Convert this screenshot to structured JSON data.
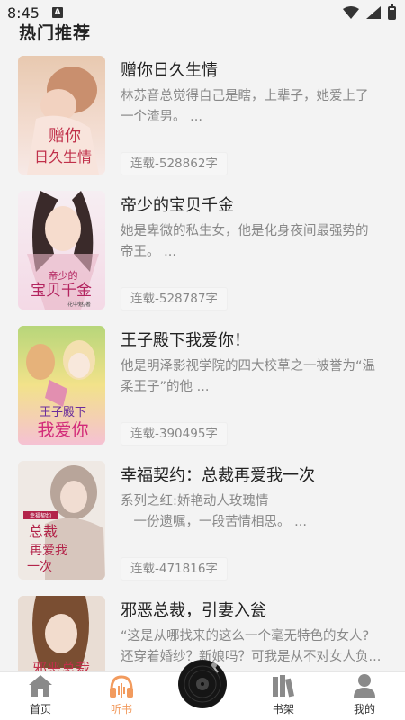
{
  "status_bar": {
    "time": "8:45",
    "notification_letter": "A"
  },
  "section": {
    "title": "热门推荐"
  },
  "books": [
    {
      "title": "赠你日久生情",
      "desc_lines": [
        "林苏音总觉得自己是瞎，上辈子，她爱上了",
        "一个渣男。 ..."
      ],
      "tag": "连载-528862字",
      "cover_text": "赠你日久生情"
    },
    {
      "title": "帝少的宝贝千金",
      "desc_lines": [
        "她是卑微的私生女，他是化身夜间最强势的",
        "帝王。 ..."
      ],
      "tag": "连载-528787字",
      "cover_text": "帝少的宝贝千金",
      "cover_author": "花中魅/著"
    },
    {
      "title": "王子殿下我爱你！",
      "desc_lines": [
        "他是明泽影视学院的四大校草之一被誉为“温",
        "柔王子”的他 ..."
      ],
      "tag": "连载-390495字",
      "cover_text": "王子殿下我爱你"
    },
    {
      "title": "幸福契约：总裁再爱我一次",
      "desc_lines": [
        "系列之红:娇艳动人玫瑰情",
        "　一份遗嘱，一段苦情相思。 ..."
      ],
      "tag": "连载-471816字",
      "cover_text": "总裁再爱我一次"
    },
    {
      "title": "邪恶总裁，引妻入瓮",
      "desc_lines": [
        "“这是从哪找来的这么一个毫无特色的女人?",
        "还穿着婚纱？新娘吗？可我是从不对女人负..."
      ],
      "tag": "",
      "cover_text": "邪恶总裁"
    }
  ],
  "bottom_nav": {
    "items": [
      {
        "label": "首页",
        "icon": "home-icon"
      },
      {
        "label": "听书",
        "icon": "headphones-icon",
        "active": true
      },
      {
        "label": "",
        "icon": "vinyl-disc-icon"
      },
      {
        "label": "书架",
        "icon": "bookshelf-icon"
      },
      {
        "label": "我的",
        "icon": "user-icon"
      }
    ]
  },
  "colors": {
    "accent": "#f29b5e",
    "background": "#f3f3f3",
    "text_primary": "#222222",
    "text_secondary": "#888888"
  }
}
